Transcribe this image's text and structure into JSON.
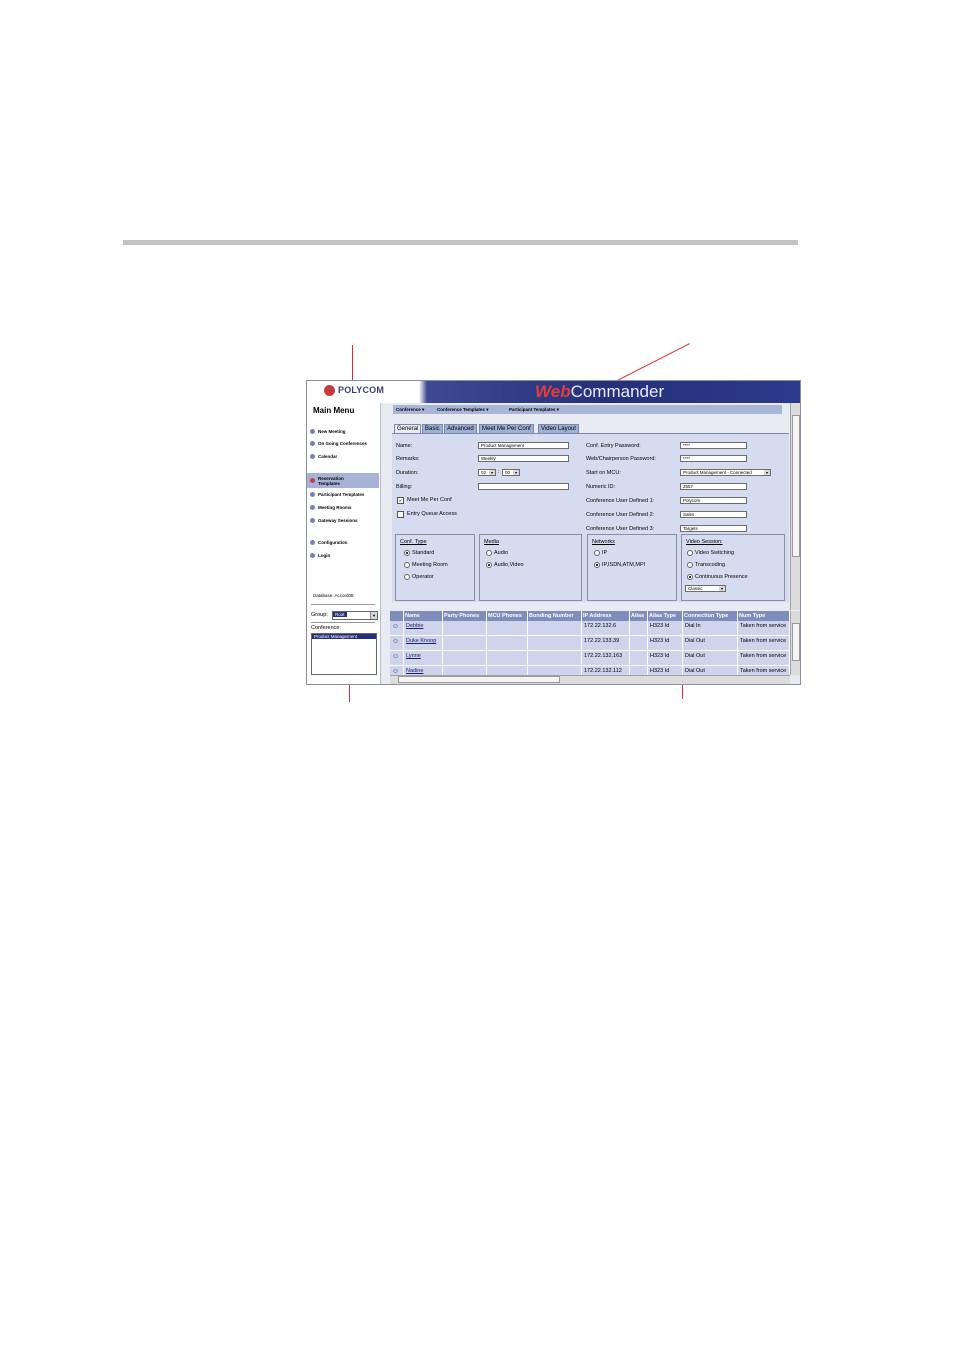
{
  "app": {
    "brand": "POLYCOM",
    "title_web": "Web",
    "title_rest": "Commander"
  },
  "sidebar": {
    "title": "Main Menu",
    "items": [
      {
        "label": "New Meeting"
      },
      {
        "label": "On Going Conferences"
      },
      {
        "label": "Calendar"
      },
      {
        "label": "Reservation Templates",
        "selected": true
      },
      {
        "label": "Participant Templates"
      },
      {
        "label": "Meeting Rooms"
      },
      {
        "label": "Gateway Sessions"
      },
      {
        "label": "Configuration"
      },
      {
        "label": "Login"
      }
    ],
    "database_label": "Database: Accord08",
    "group_label": "Group:",
    "group_value": "Root",
    "conference_label": "Conference:",
    "conferences": [
      "Product Management"
    ]
  },
  "menubar": {
    "items": [
      "Conference",
      "Conference Templates",
      "Participant Templates"
    ]
  },
  "tabs": [
    "General",
    "Basic",
    "Advanced",
    "Meet Me Per Conf",
    "Video Layout"
  ],
  "form": {
    "name_label": "Name:",
    "name_value": "Product Management",
    "remarks_label": "Remarks:",
    "remarks_value": "Weekly",
    "duration_label": "Duration:",
    "duration_hours": "02",
    "duration_minutes": "00",
    "duration_sep": ":",
    "billing_label": "Billing:",
    "billing_value": "",
    "meetme_label": "Meet Me Per Conf",
    "meetme_checked": true,
    "entryqueue_label": "Entry Queue Access",
    "entryqueue_checked": false,
    "entry_pw_label": "Conf. Entry Password:",
    "entry_pw_value": "****",
    "chair_pw_label": "Web/Chairperson Password:",
    "chair_pw_value": "****",
    "mcu_label": "Start on MCU:",
    "mcu_value": "Product Management - Connected",
    "numeric_label": "Numeric ID:",
    "numeric_value": "2557",
    "ud1_label": "Conference User Defined 1:",
    "ud1_value": "Polycom",
    "ud2_label": "Conference User Defined 2:",
    "ud2_value": "Sales",
    "ud3_label": "Conference User Defined 3:",
    "ud3_value": "Targets"
  },
  "groups": {
    "conf_type": {
      "title": "Conf. Type",
      "options": [
        "Standard",
        "Meeting Room",
        "Operator"
      ],
      "selected": 0
    },
    "media": {
      "title": "Media",
      "options": [
        "Audio",
        "Audio,Video"
      ],
      "selected": 1
    },
    "networks": {
      "title": "Networks",
      "options": [
        "IP",
        "IP,ISDN,ATM,MPI"
      ],
      "selected": 1
    },
    "video_session": {
      "title": "Video Session:",
      "options": [
        "Video Switching",
        "Transcoding",
        "Continuous Presence"
      ],
      "selected": 2,
      "layout_value": "Classic"
    }
  },
  "grid": {
    "columns": [
      "Name",
      "Party Phones",
      "MCU Phones",
      "Bonding Number",
      "IP Address",
      "Alias",
      "Alias Type",
      "Connection Type",
      "Num Type"
    ],
    "rows": [
      {
        "name": "Debbie",
        "ip": "172.22.132.6",
        "alias_type": "H323 Id",
        "connection": "Dial In",
        "num_type": "Taken from service"
      },
      {
        "name": "Duke Knoop",
        "ip": "172.22.133.39",
        "alias_type": "H323 Id",
        "connection": "Dial Out",
        "num_type": "Taken from service"
      },
      {
        "name": "Lynne",
        "ip": "172.22.132.163",
        "alias_type": "H323 Id",
        "connection": "Dial Out",
        "num_type": "Taken from service"
      },
      {
        "name": "Nadine",
        "ip": "172.22.132.112",
        "alias_type": "H323 Id",
        "connection": "Dial Out",
        "num_type": "Taken from service"
      }
    ]
  },
  "colors": {
    "callout": "#d43030",
    "banner": "#24307a",
    "panel": "#d6dcef",
    "grid_header": "#7f8dbb"
  }
}
